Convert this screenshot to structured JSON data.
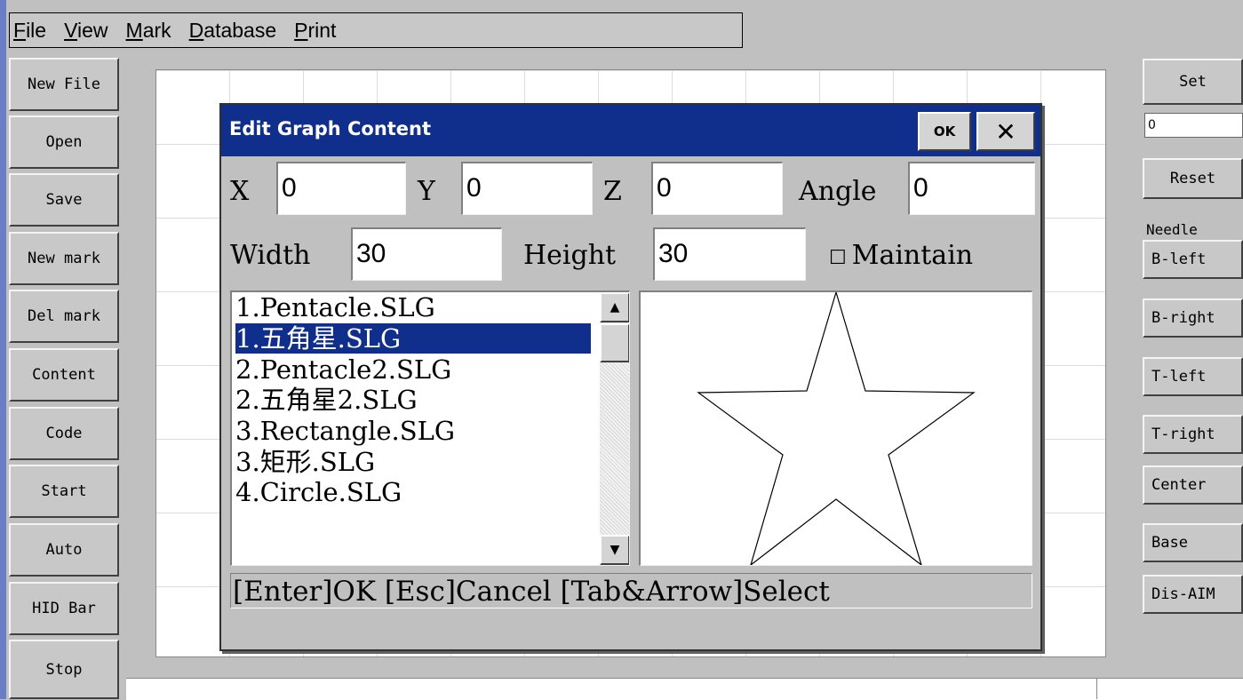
{
  "menu": {
    "items": [
      "File",
      "View",
      "Mark",
      "Database",
      "Print"
    ],
    "underline": [
      "F",
      "V",
      "M",
      "D",
      "P"
    ]
  },
  "left_buttons": [
    "New File",
    "Open",
    "Save",
    "New mark",
    "Del mark",
    "Content",
    "Code",
    "Start",
    "Auto",
    "HID Bar",
    "Stop"
  ],
  "right_panel": {
    "set_label": "Set",
    "set_value": "0",
    "reset_label": "Reset",
    "needle_label": "Needle",
    "buttons": [
      "B-left",
      "B-right",
      "T-left",
      "T-right",
      "Center",
      "Base",
      "Dis-AIM"
    ]
  },
  "dialog": {
    "title": "Edit Graph Content",
    "ok_label": "OK",
    "close_glyph": "✕",
    "x_label": "X",
    "x_value": "0",
    "y_label": "Y",
    "y_value": "0",
    "z_label": "Z",
    "z_value": "0",
    "angle_label": "Angle",
    "angle_value": "0",
    "width_label": "Width",
    "width_value": "30",
    "height_label": "Height",
    "height_value": "30",
    "maintain_label": "Maintain",
    "checkbox_glyph": "☐",
    "files": [
      "1.Pentacle.SLG",
      "1.五角星.SLG",
      "2.Pentacle2.SLG",
      "2.五角星2.SLG",
      "3.Rectangle.SLG",
      "3.矩形.SLG",
      "4.Circle.SLG"
    ],
    "selected_file": "1.五角星.SLG",
    "preview_shape": "star-outline",
    "hint": "[Enter]OK [Esc]Cancel [Tab&Arrow]Select"
  },
  "icons": {
    "scroll_up": "▲",
    "scroll_down": "▼"
  }
}
